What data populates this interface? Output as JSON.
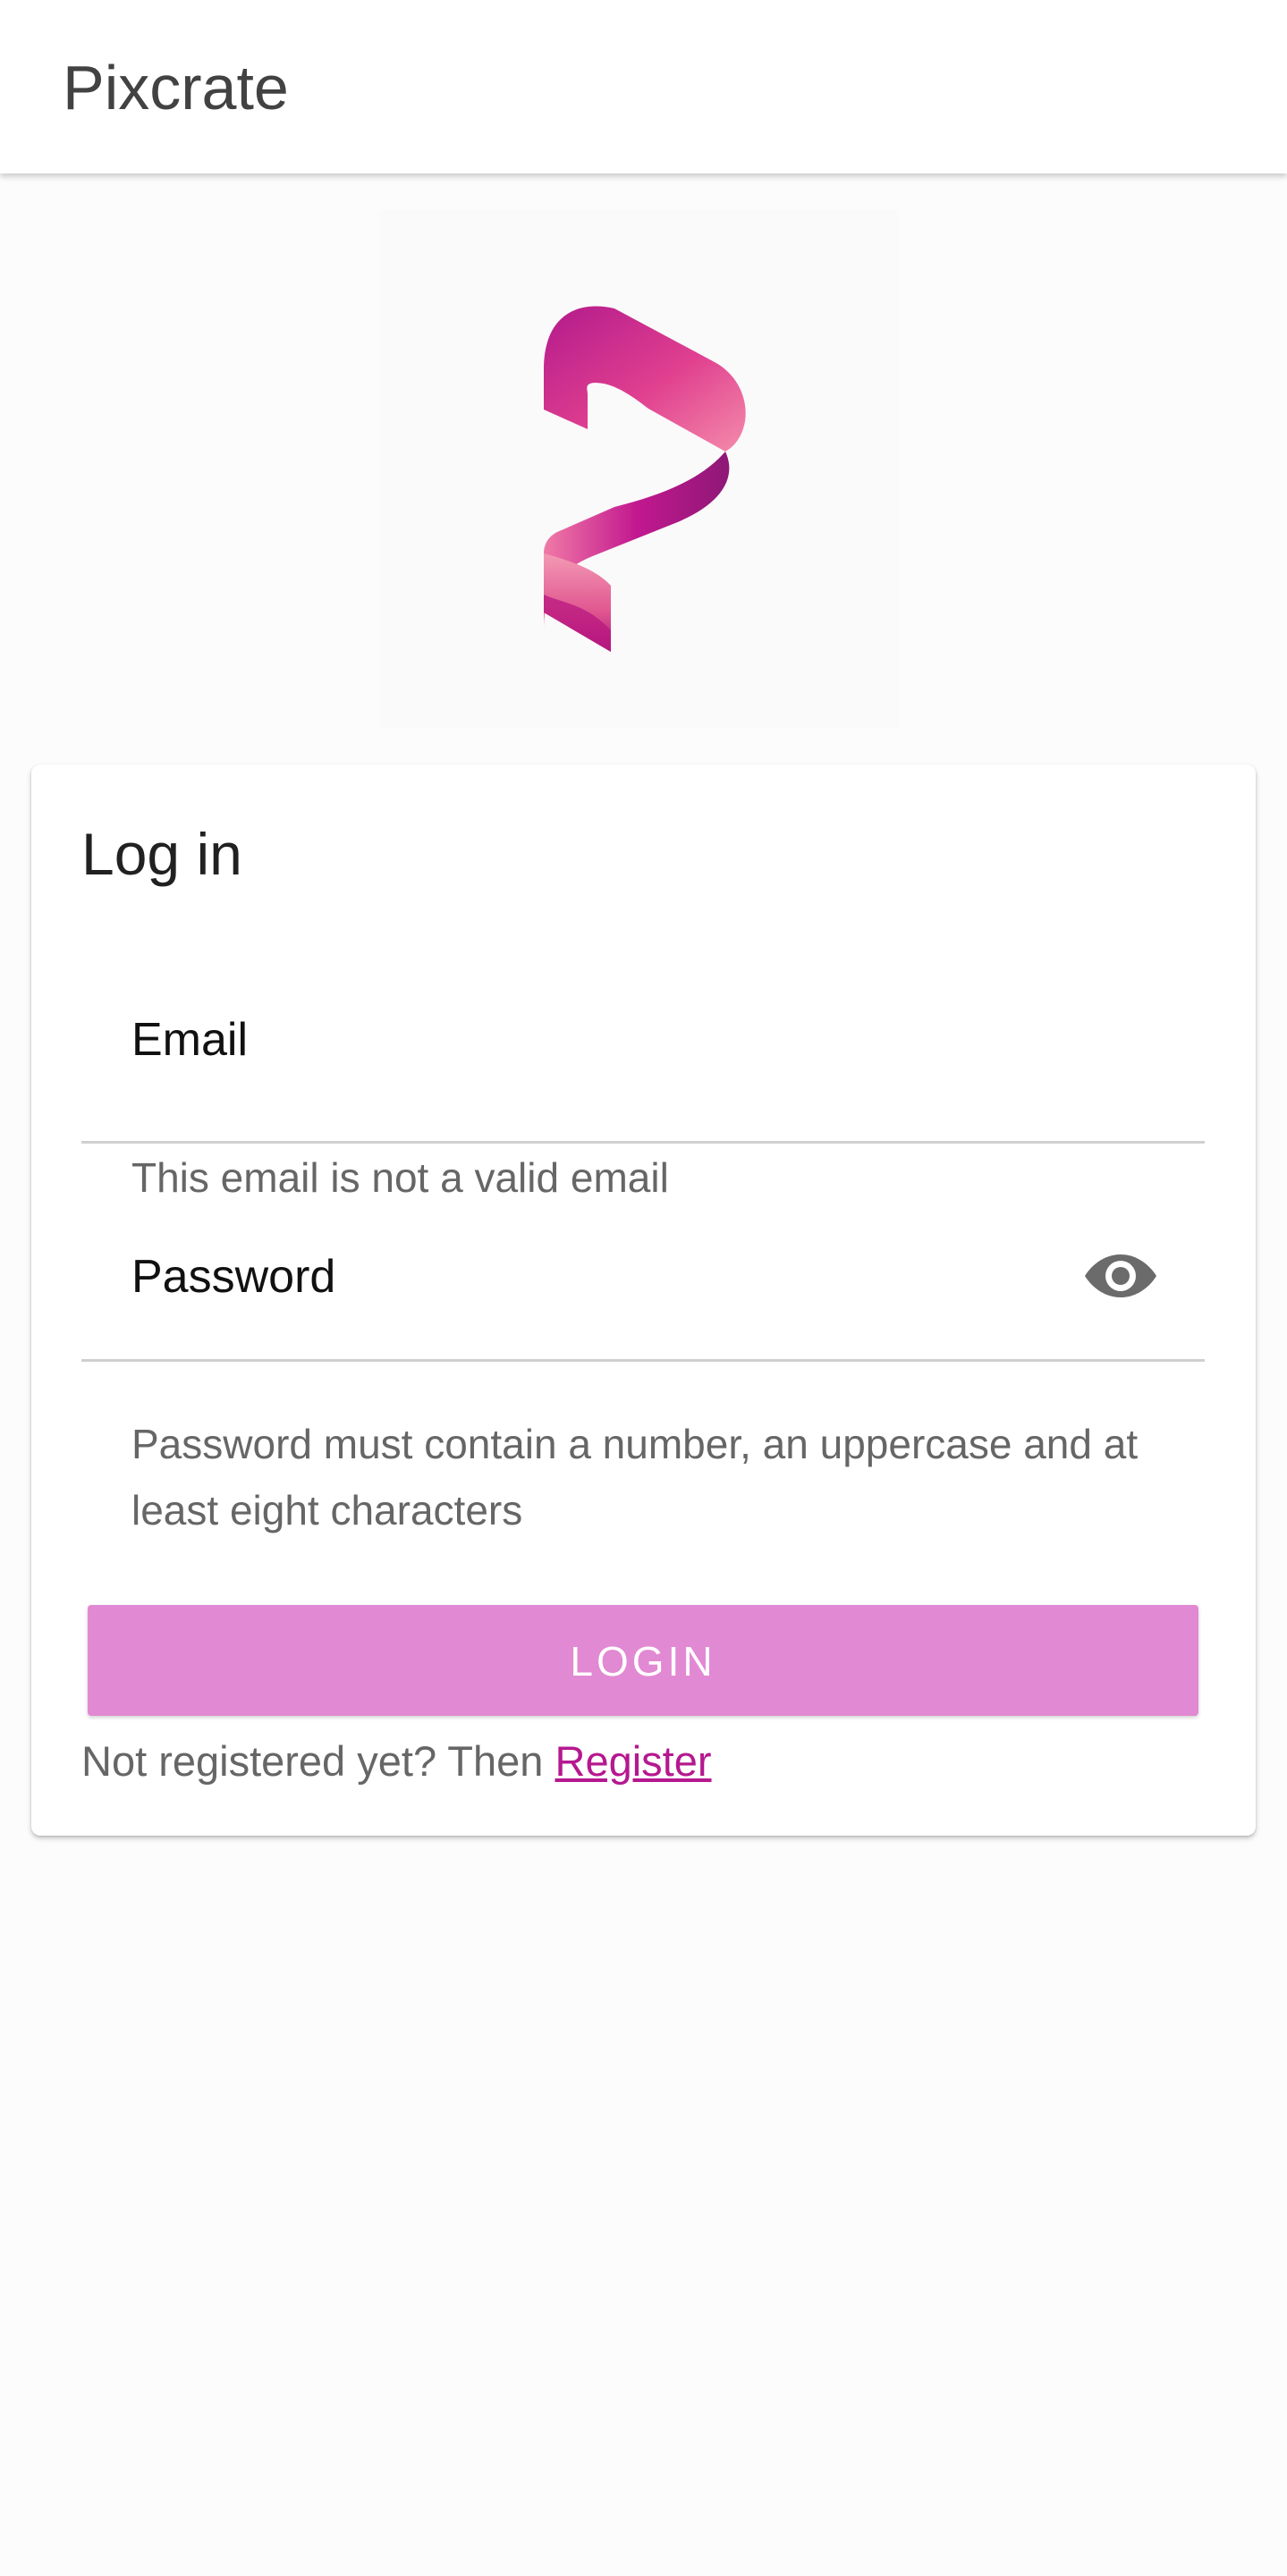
{
  "app_bar": {
    "title": "Pixcrate"
  },
  "logo": {
    "icon": "pixcrate-logo",
    "colors": {
      "primary": "#c2188f",
      "light": "#f06fa5",
      "dark": "#8e1876"
    }
  },
  "login_card": {
    "title": "Log in",
    "email": {
      "label": "Email",
      "value": "",
      "error": "This email is not a valid email"
    },
    "password": {
      "label": "Password",
      "value": "",
      "toggle_icon": "eye-icon",
      "hint": "Password must contain a number, an uppercase and at least eight characters"
    },
    "login_button": "LOGIN",
    "register_prompt": "Not registered yet? Then",
    "register_link": "Register"
  },
  "colors": {
    "accent": "#e289d3",
    "link": "#b5188f",
    "app_bar_text": "#424242",
    "hint_text": "#666666"
  }
}
